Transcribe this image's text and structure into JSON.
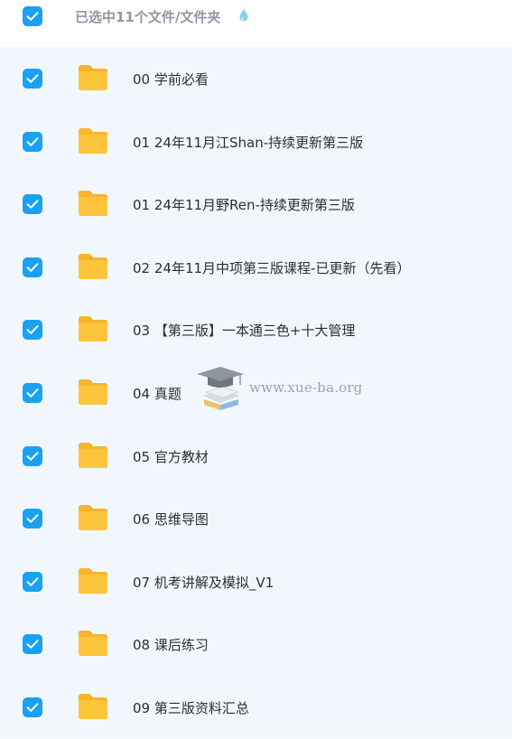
{
  "header": {
    "selection_text": "已选中11个文件/文件夹"
  },
  "items": [
    {
      "label": "00 学前必看"
    },
    {
      "label": "01 24年11月江Shan-持续更新第三版"
    },
    {
      "label": "01 24年11月野Ren-持续更新第三版"
    },
    {
      "label": "02 24年11月中项第三版课程-已更新（先看）"
    },
    {
      "label": "03 【第三版】一本通三色+十大管理"
    },
    {
      "label": "04 真题"
    },
    {
      "label": "05 官方教材"
    },
    {
      "label": "06 思维导图"
    },
    {
      "label": "07 机考讲解及模拟_V1"
    },
    {
      "label": "08 课后练习"
    },
    {
      "label": "09 第三版资料汇总"
    }
  ],
  "watermark": {
    "text": "www.xue-ba.org"
  },
  "colors": {
    "checkbox": "#1aa1f5",
    "folder": "#fdc53c",
    "list_background": "#f1f7fd",
    "header_text": "#8d97a3"
  }
}
